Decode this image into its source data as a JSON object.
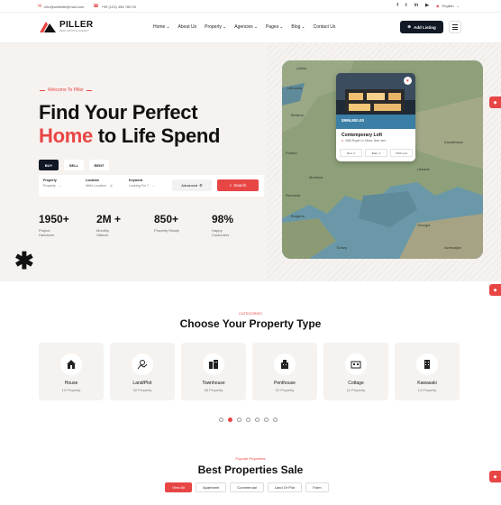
{
  "topbar": {
    "email": "info@website@mail.com",
    "phone": "+99 (123) 456 789 00",
    "language": "English",
    "social_icons": [
      "facebook-icon",
      "twitter-icon",
      "linkedin-icon",
      "youtube-icon"
    ]
  },
  "brand": {
    "name": "PILLER",
    "tagline": "REAL ESTATE AGENCY"
  },
  "nav": {
    "items": [
      {
        "label": "Home",
        "dropdown": true
      },
      {
        "label": "About Us",
        "dropdown": false
      },
      {
        "label": "Property",
        "dropdown": true
      },
      {
        "label": "Agencies",
        "dropdown": true
      },
      {
        "label": "Pages",
        "dropdown": true
      },
      {
        "label": "Blog",
        "dropdown": true
      },
      {
        "label": "Contact Us",
        "dropdown": false
      }
    ],
    "add_listing": "Add Listing"
  },
  "hero": {
    "eyebrow": "Welcome To Piller",
    "title_line1": "Find Your Perfect",
    "title_accent": "Home",
    "title_line2_rest": " to Life Spend",
    "tabs": [
      "BUY",
      "SELL",
      "RENT"
    ],
    "active_tab": "BUY",
    "search": {
      "property_label": "Property",
      "property_value": "Property",
      "location_label": "Location",
      "location_value": "Write Location",
      "keyword_label": "Keyword",
      "keyword_value": "Looking For ?",
      "advanced": "Advanced",
      "search_button": "Search"
    },
    "stats": [
      {
        "number": "1950+",
        "label": "Project Handover"
      },
      {
        "number": "2M +",
        "label": "Monthly Visitors"
      },
      {
        "number": "850+",
        "label": "Property Ready"
      },
      {
        "number": "98%",
        "label": "Happy Customers"
      }
    ]
  },
  "map": {
    "labels": [
      "Latvia",
      "Lithuania",
      "Belarus",
      "Poland",
      "Ukraine",
      "Moldova",
      "Romania",
      "Bulgaria",
      "Turkey",
      "Georgia",
      "Azerbaijan",
      "Kazakhstan"
    ],
    "card": {
      "price": "$999,800.00",
      "title": "Contemporary Loft",
      "address": "2464 Royal Ln. Mesa, New Jers",
      "features": [
        "Bed: 4",
        "Bath: 2",
        "1500 sq ft"
      ]
    }
  },
  "categories": {
    "eyebrow": "CATEGORIES",
    "title": "Choose Your Property Type",
    "items": [
      {
        "name": "House",
        "count": "10 Property",
        "icon": "house-icon"
      },
      {
        "name": "Land/Plot",
        "count": "02 Property",
        "icon": "land-plot-icon"
      },
      {
        "name": "Townhouse",
        "count": "05 Property",
        "icon": "townhouse-icon"
      },
      {
        "name": "Penthouse",
        "count": "02 Property",
        "icon": "penthouse-icon"
      },
      {
        "name": "Cottage",
        "count": "11 Property",
        "icon": "cottage-icon"
      },
      {
        "name": "Kawasaki",
        "count": "14 Property",
        "icon": "building-icon"
      }
    ],
    "pager_count": 7,
    "pager_active": 1
  },
  "best": {
    "eyebrow": "Popular Properties",
    "title": "Best Properties Sale",
    "filters": [
      "View All",
      "Apartment",
      "Commercial",
      "Land Or Plot",
      "Farm"
    ],
    "active_filter": "View All"
  },
  "colors": {
    "accent": "#e84545",
    "dark": "#111826",
    "hero_bg": "#f6f2ef"
  }
}
